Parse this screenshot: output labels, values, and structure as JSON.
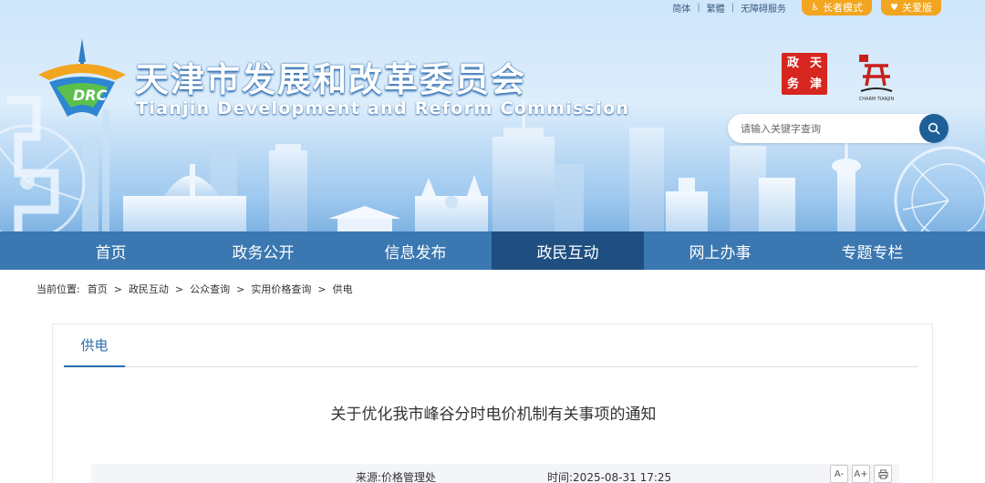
{
  "top_bar": {
    "simplified": "简体",
    "traditional": "繁體",
    "accessibility": "无障碍服务",
    "elder_mode": "长者模式",
    "care_mode": "关爱版"
  },
  "site": {
    "title_cn": "天津市发展和改革委员会",
    "title_en": "Tianjin Development and Reform Commission",
    "logo_text": "DRC",
    "badge_red_chars": [
      "天",
      "津",
      "政",
      "务"
    ],
    "badge_tj_caption": "CHARM TIANJIN"
  },
  "search": {
    "placeholder": "请输入关键字查询"
  },
  "nav": {
    "items": [
      "首页",
      "政务公开",
      "信息发布",
      "政民互动",
      "网上办事",
      "专题专栏"
    ],
    "active_index": 3
  },
  "breadcrumb": {
    "lead": "当前位置:",
    "items": [
      "首页",
      "政民互动",
      "公众查询",
      "实用价格查询",
      "供电"
    ],
    "separator": ">"
  },
  "content": {
    "tab_label": "供电",
    "article_title": "关于优化我市峰谷分时电价机制有关事项的通知",
    "source": "来源:价格管理处",
    "time": "时间:2025-08-31 17:25",
    "font_decrease": "A-",
    "font_increase": "A+"
  },
  "colors": {
    "nav_bg": "#3b77b0",
    "nav_active_bg": "#1e4f80",
    "accent_orange": "#f2a51e",
    "accent_blue": "#2b6cad"
  }
}
